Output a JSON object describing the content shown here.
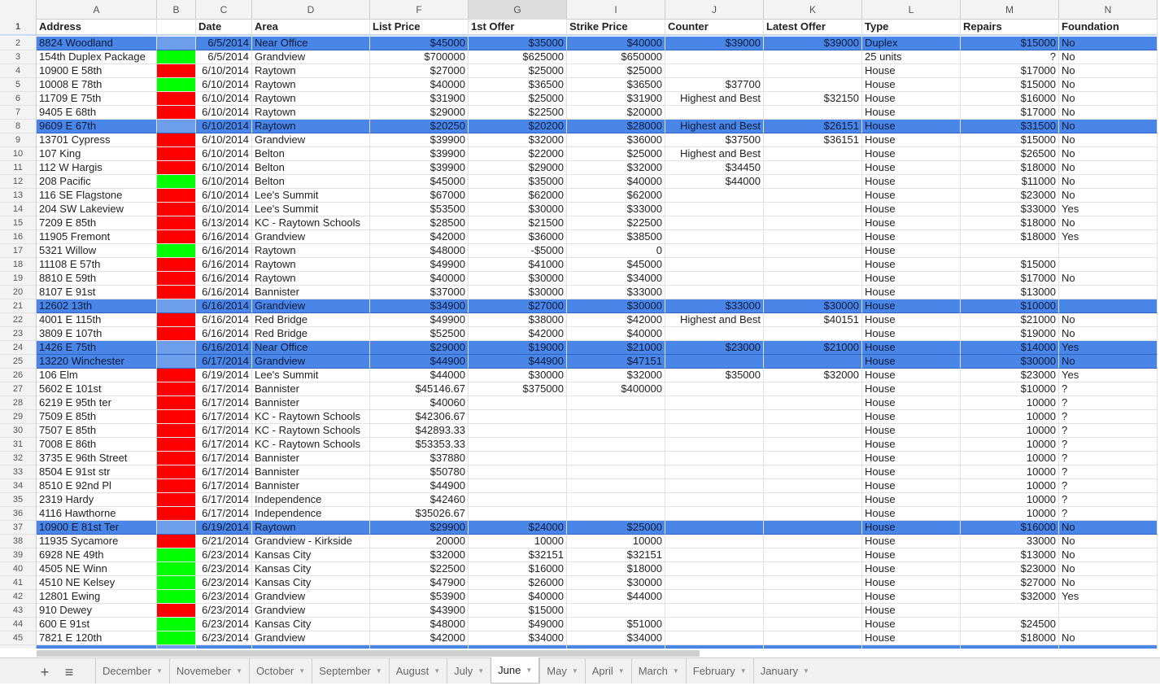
{
  "columns": [
    "A",
    "B",
    "C",
    "D",
    "F",
    "G",
    "I",
    "J",
    "K",
    "L",
    "M",
    "N"
  ],
  "header": [
    "Address",
    "",
    "Date",
    "Area",
    "List Price",
    "1st Offer",
    "Strike Price",
    "Counter",
    "Latest Offer",
    "Type",
    "Repairs",
    "Foundation"
  ],
  "colors": {
    "green": "#00ff00",
    "red": "#ff0000",
    "highlight": "#4a86e8"
  },
  "rows": [
    [
      "2",
      "8824 Woodland",
      "b",
      "6/5/2014",
      "Near Office",
      "$45000",
      "$35000",
      "$40000",
      "$39000",
      "$39000",
      "Duplex",
      "$15000",
      "No"
    ],
    [
      "3",
      "154th Duplex Package",
      "g",
      "6/5/2014",
      "Grandview",
      "$700000",
      "$625000",
      "$650000",
      "",
      "",
      "25 units",
      "?",
      "No"
    ],
    [
      "4",
      "10900 E 58th",
      "r",
      "6/10/2014",
      "Raytown",
      "$27000",
      "$25000",
      "$25000",
      "",
      "",
      "House",
      "$17000",
      "No"
    ],
    [
      "5",
      "10008 E 78th",
      "g",
      "6/10/2014",
      "Raytown",
      "$40000",
      "$36500",
      "$36500",
      "$37700",
      "",
      "House",
      "$15000",
      "No"
    ],
    [
      "6",
      "11709 E 75th",
      "r",
      "6/10/2014",
      "Raytown",
      "$31900",
      "$25000",
      "$31900",
      "Highest and Best",
      "$32150",
      "House",
      "$16000",
      "No"
    ],
    [
      "7",
      "9405 E 68th",
      "r",
      "6/10/2014",
      "Raytown",
      "$29000",
      "$22500",
      "$20000",
      "",
      "",
      "House",
      "$17000",
      "No"
    ],
    [
      "8",
      "9609 E 67th",
      "b",
      "6/10/2014",
      "Raytown",
      "$20250",
      "$20200",
      "$28000",
      "Highest and Best",
      "$26151",
      "House",
      "$31500",
      "No"
    ],
    [
      "9",
      "13701 Cypress",
      "r",
      "6/10/2014",
      "Grandview",
      "$39900",
      "$32000",
      "$36000",
      "$37500",
      "$36151",
      "House",
      "$15000",
      "No"
    ],
    [
      "10",
      "107 King",
      "r",
      "6/10/2014",
      "Belton",
      "$39900",
      "$22000",
      "$25000",
      "Highest and Best",
      "",
      "House",
      "$26500",
      "No"
    ],
    [
      "11",
      "112 W Hargis",
      "r",
      "6/10/2014",
      "Belton",
      "$39900",
      "$29000",
      "$32000",
      "$34450",
      "",
      "House",
      "$18000",
      "No"
    ],
    [
      "12",
      "208 Pacific",
      "g",
      "6/10/2014",
      "Belton",
      "$45000",
      "$35000",
      "$40000",
      "$44000",
      "",
      "House",
      "$11000",
      "No"
    ],
    [
      "13",
      "116 SE Flagstone",
      "r",
      "6/10/2014",
      "Lee's Summit",
      "$67000",
      "$62000",
      "$62000",
      "",
      "",
      "House",
      "$23000",
      "No"
    ],
    [
      "14",
      "204 SW Lakeview",
      "r",
      "6/10/2014",
      "Lee's Summit",
      "$53500",
      "$30000",
      "$33000",
      "",
      "",
      "House",
      "$33000",
      "Yes"
    ],
    [
      "15",
      "7209 E 85th",
      "r",
      "6/13/2014",
      "KC - Raytown Schools",
      "$28500",
      "$21500",
      "$22500",
      "",
      "",
      "House",
      "$18000",
      "No"
    ],
    [
      "16",
      "11905 Fremont",
      "r",
      "6/16/2014",
      "Grandview",
      "$42000",
      "$36000",
      "$38500",
      "",
      "",
      "House",
      "$18000",
      "Yes"
    ],
    [
      "17",
      "5321 Willow",
      "g",
      "6/16/2014",
      "Raytown",
      "$48000",
      "-$5000",
      "0",
      "",
      "",
      "House",
      "",
      ""
    ],
    [
      "18",
      "11108 E 57th",
      "r",
      "6/16/2014",
      "Raytown",
      "$49900",
      "$41000",
      "$45000",
      "",
      "",
      "House",
      "$15000",
      ""
    ],
    [
      "19",
      "8810 E 59th",
      "r",
      "6/16/2014",
      "Raytown",
      "$40000",
      "$30000",
      "$34000",
      "",
      "",
      "House",
      "$17000",
      "No"
    ],
    [
      "20",
      "8107 E 91st",
      "r",
      "6/16/2014",
      "Bannister",
      "$37000",
      "$30000",
      "$33000",
      "",
      "",
      "House",
      "$13000",
      ""
    ],
    [
      "21",
      "12602 13th",
      "b",
      "6/16/2014",
      "Grandview",
      "$34900",
      "$27000",
      "$30000",
      "$33000",
      "$30000",
      "House",
      "$10000",
      ""
    ],
    [
      "22",
      "4001 E 115th",
      "r",
      "6/16/2014",
      "Red Bridge",
      "$49900",
      "$38000",
      "$42000",
      "Highest and Best",
      "$40151",
      "House",
      "$21000",
      "No"
    ],
    [
      "23",
      "3809 E 107th",
      "r",
      "6/16/2014",
      "Red Bridge",
      "$52500",
      "$42000",
      "$40000",
      "",
      "",
      "House",
      "$19000",
      "No"
    ],
    [
      "24",
      "1426 E 75th",
      "b",
      "6/16/2014",
      "Near Office",
      "$29000",
      "$19000",
      "$21000",
      "$23000",
      "$21000",
      "House",
      "$14000",
      "Yes"
    ],
    [
      "25",
      "13220 Winchester",
      "b",
      "6/17/2014",
      "Grandview",
      "$44900",
      "$44900",
      "$47151",
      "",
      "",
      "House",
      "$30000",
      "No"
    ],
    [
      "26",
      "106 Elm",
      "r",
      "6/19/2014",
      "Lee's Summit",
      "$44000",
      "$30000",
      "$32000",
      "$35000",
      "$32000",
      "House",
      "$23000",
      "Yes"
    ],
    [
      "27",
      "5602 E 101st",
      "r",
      "6/17/2014",
      "Bannister",
      "$45146.67",
      "$375000",
      "$400000",
      "",
      "",
      "House",
      "$10000",
      "?"
    ],
    [
      "28",
      "6219 E 95th ter",
      "r",
      "6/17/2014",
      "Bannister",
      "$40060",
      "",
      "",
      "",
      "",
      "House",
      "10000",
      "?"
    ],
    [
      "29",
      "7509 E 85th",
      "r",
      "6/17/2014",
      "KC - Raytown Schools",
      "$42306.67",
      "",
      "",
      "",
      "",
      "House",
      "10000",
      "?"
    ],
    [
      "30",
      "7507 E 85th",
      "r",
      "6/17/2014",
      "KC - Raytown Schools",
      "$42893.33",
      "",
      "",
      "",
      "",
      "House",
      "10000",
      "?"
    ],
    [
      "31",
      "7008 E 86th",
      "r",
      "6/17/2014",
      "KC - Raytown Schools",
      "$53353.33",
      "",
      "",
      "",
      "",
      "House",
      "10000",
      "?"
    ],
    [
      "32",
      "3735 E 96th Street",
      "r",
      "6/17/2014",
      "Bannister",
      "$37880",
      "",
      "",
      "",
      "",
      "House",
      "10000",
      "?"
    ],
    [
      "33",
      "8504 E 91st str",
      "r",
      "6/17/2014",
      "Bannister",
      "$50780",
      "",
      "",
      "",
      "",
      "House",
      "10000",
      "?"
    ],
    [
      "34",
      "8510 E 92nd Pl",
      "r",
      "6/17/2014",
      "Bannister",
      "$44900",
      "",
      "",
      "",
      "",
      "House",
      "10000",
      "?"
    ],
    [
      "35",
      "2319 Hardy",
      "r",
      "6/17/2014",
      "Independence",
      "$42460",
      "",
      "",
      "",
      "",
      "House",
      "10000",
      "?"
    ],
    [
      "36",
      "4116 Hawthorne",
      "r",
      "6/17/2014",
      "Independence",
      "$35026.67",
      "",
      "",
      "",
      "",
      "House",
      "10000",
      "?"
    ],
    [
      "37",
      "10900 E 81st Ter",
      "b",
      "6/19/2014",
      "Raytown",
      "$29900",
      "$24000",
      "$25000",
      "",
      "",
      "House",
      "$16000",
      "No"
    ],
    [
      "38",
      "11935 Sycamore",
      "r",
      "6/21/2014",
      "Grandview - Kirkside",
      "20000",
      "10000",
      "10000",
      "",
      "",
      "House",
      "33000",
      "No"
    ],
    [
      "39",
      "6928 NE 49th",
      "g",
      "6/23/2014",
      "Kansas City",
      "$32000",
      "$32151",
      "$32151",
      "",
      "",
      "House",
      "$13000",
      "No"
    ],
    [
      "40",
      "4505 NE Winn",
      "g",
      "6/23/2014",
      "Kansas City",
      "$22500",
      "$16000",
      "$18000",
      "",
      "",
      "House",
      "$23000",
      "No"
    ],
    [
      "41",
      "4510 NE Kelsey",
      "g",
      "6/23/2014",
      "Kansas City",
      "$47900",
      "$26000",
      "$30000",
      "",
      "",
      "House",
      "$27000",
      "No"
    ],
    [
      "42",
      "12801 Ewing",
      "g",
      "6/23/2014",
      "Grandview",
      "$53900",
      "$40000",
      "$44000",
      "",
      "",
      "House",
      "$32000",
      "Yes"
    ],
    [
      "43",
      "910 Dewey",
      "r",
      "6/23/2014",
      "Grandview",
      "$43900",
      "$15000",
      "",
      "",
      "",
      "House",
      "",
      ""
    ],
    [
      "44",
      "600 E 91st",
      "g",
      "6/23/2014",
      "Kansas City",
      "$48000",
      "$49000",
      "$51000",
      "",
      "",
      "House",
      "$24500",
      ""
    ],
    [
      "45",
      "7821 E 120th",
      "g",
      "6/23/2014",
      "Grandview",
      "$42000",
      "$34000",
      "$34000",
      "",
      "",
      "House",
      "$18000",
      "No"
    ]
  ],
  "tabbar": {
    "add_icon": "+",
    "menu_icon": "≡",
    "active": "June",
    "tabs": [
      "December",
      "Novemeber",
      "October",
      "September",
      "August",
      "July",
      "June",
      "May",
      "April",
      "March",
      "February",
      "January"
    ]
  }
}
